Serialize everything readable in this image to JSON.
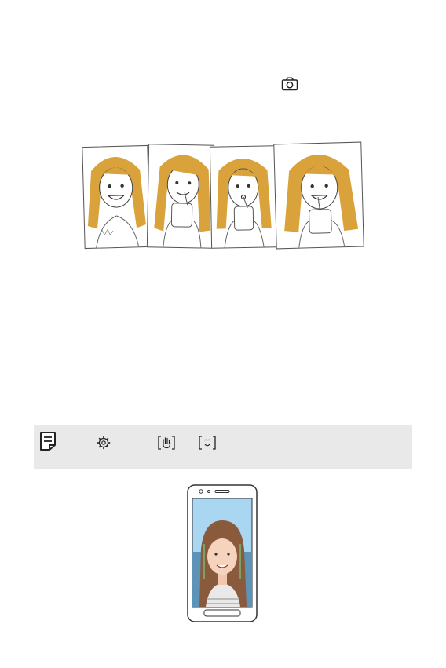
{
  "icons": {
    "camera": "camera-icon",
    "note": "note-icon",
    "settings": "gear-icon",
    "gesture": "hand-gesture-icon",
    "auto_shot": "face-auto-shot-icon"
  },
  "colors": {
    "note_background": "#e9e9e9",
    "hair": "#d9a23a",
    "sky": "#a9d6f0",
    "face_guide": "#7cc47c"
  }
}
